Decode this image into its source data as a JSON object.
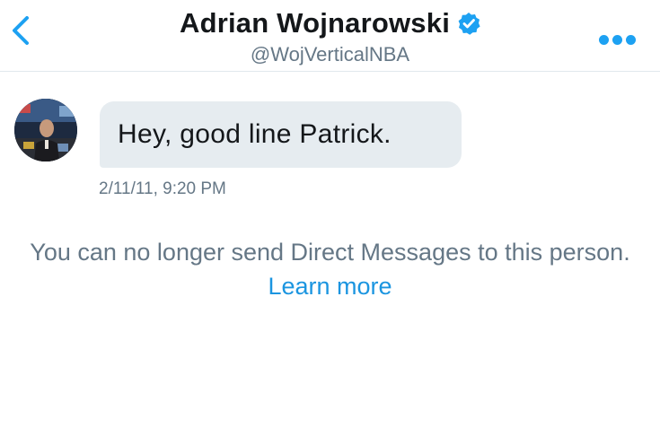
{
  "header": {
    "title": "Adrian Wojnarowski",
    "handle": "@WojVerticalNBA",
    "back_icon": "chevron-left-icon",
    "more_icon": "more-dots-icon",
    "verified_icon": "verified-badge-icon"
  },
  "conversation": {
    "messages": [
      {
        "text": "Hey, good line Patrick.",
        "timestamp": "2/11/11, 9:20 PM"
      }
    ]
  },
  "notice": {
    "text": "You can no longer send Direct Messages to this person.",
    "link_label": "Learn more"
  },
  "colors": {
    "accent": "#1da1f2",
    "link": "#1b95e0",
    "secondary_text": "#657786",
    "bubble": "#e6ecf0",
    "divider": "#e1e8ed"
  }
}
